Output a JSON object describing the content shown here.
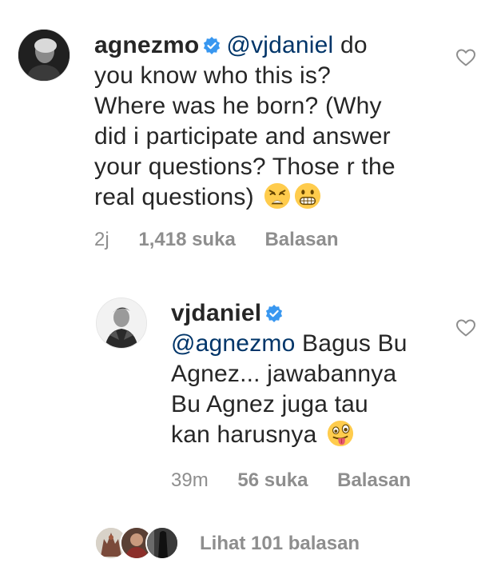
{
  "comment": {
    "username": "agnezmo",
    "mention": "@vjdaniel",
    "text_lines": [
      " do",
      "you know who this is?",
      "Where was he born? (Why",
      "did i participate and answer",
      "your questions? Those r the",
      "real questions)"
    ],
    "time": "2j",
    "likes": "1,418 suka",
    "reply_label": "Balasan",
    "emojis": [
      "weary-face-emoji",
      "grinning-face-emoji"
    ]
  },
  "reply": {
    "username": "vjdaniel",
    "mention": "@agnezmo",
    "text_lines": [
      " Bagus Bu",
      "Agnez... jawabannya",
      "Bu Agnez juga tau",
      "kan harusnya"
    ],
    "time": "39m",
    "likes": "56 suka",
    "reply_label": "Balasan",
    "emojis": [
      "winking-tongue-face-emoji"
    ]
  },
  "view_replies": {
    "label": "Lihat 101 balasan"
  },
  "colors": {
    "text": "#262626",
    "mention": "#003569",
    "meta": "#8e8e8e",
    "verified": "#3897f0",
    "emoji": "#ffcc4d"
  },
  "icons": [
    "verified-badge-icon",
    "heart-outline-icon"
  ]
}
